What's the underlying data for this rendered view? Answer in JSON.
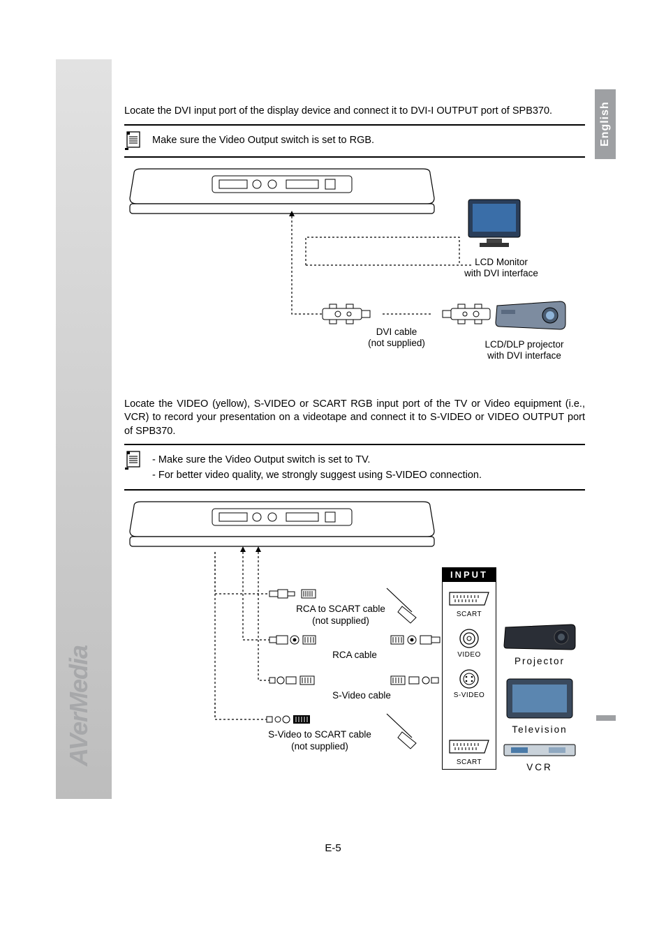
{
  "brand": "AVerMedia",
  "language_tab": "English",
  "page_number": "E-5",
  "section1": {
    "paragraph": "Locate the DVI input port of the display device and connect it to DVI-I OUTPUT port of SPB370.",
    "note": "Make sure the Video Output switch is set to RGB.",
    "labels": {
      "lcd_monitor_l1": "LCD Monitor",
      "lcd_monitor_l2": "with DVI interface",
      "dvi_cable_l1": "DVI cable",
      "dvi_cable_l2": "(not supplied)",
      "projector_l1": "LCD/DLP projector",
      "projector_l2": "with DVI interface"
    }
  },
  "section2": {
    "paragraph": "Locate the VIDEO (yellow), S-VIDEO or SCART RGB input port of the TV or Video equipment (i.e., VCR) to record your presentation on a videotape and connect it to S-VIDEO or VIDEO OUTPUT port of SPB370.",
    "note_items": [
      "Make sure the Video Output switch is set to TV.",
      "For better video quality, we strongly suggest using S-VIDEO connection."
    ],
    "labels": {
      "input": "INPUT",
      "rca_scart_l1": "RCA to SCART cable",
      "rca_scart_l2": "(not supplied)",
      "rca_cable": "RCA cable",
      "svideo_cable": "S-Video cable",
      "sv_scart_l1": "S-Video to SCART cable",
      "sv_scart_l2": "(not supplied)",
      "scart": "SCART",
      "video": "VIDEO",
      "svideo": "S-VIDEO",
      "projector": "Projector",
      "television": "Television",
      "vcr": "VCR"
    }
  }
}
